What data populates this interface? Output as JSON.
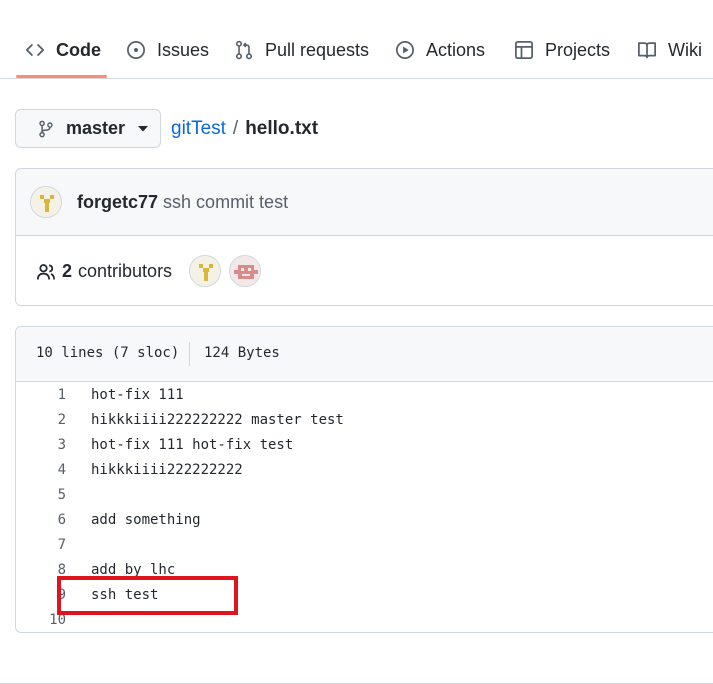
{
  "tabs": [
    {
      "label": "Code",
      "icon": "code-icon",
      "selected": true
    },
    {
      "label": "Issues",
      "icon": "issue-opened-icon",
      "selected": false
    },
    {
      "label": "Pull requests",
      "icon": "git-pull-request-icon",
      "selected": false
    },
    {
      "label": "Actions",
      "icon": "play-icon",
      "selected": false
    },
    {
      "label": "Projects",
      "icon": "table-icon",
      "selected": false
    },
    {
      "label": "Wiki",
      "icon": "book-icon",
      "selected": false
    }
  ],
  "branch": {
    "name": "master",
    "icon": "git-branch-icon"
  },
  "breadcrumb": {
    "repo": "gitTest",
    "separator": "/",
    "file": "hello.txt"
  },
  "commit": {
    "author": "forgetc77",
    "message": "ssh commit test"
  },
  "contributors": {
    "count": "2",
    "label": "contributors"
  },
  "file_info": {
    "lines": "10 lines (7 sloc)",
    "size": "124 Bytes"
  },
  "code_lines": [
    {
      "num": "1",
      "text": "hot-fix 111"
    },
    {
      "num": "2",
      "text": "hikkkiiii222222222 master test"
    },
    {
      "num": "3",
      "text": "hot-fix 111 hot-fix test"
    },
    {
      "num": "4",
      "text": "hikkkiiii222222222"
    },
    {
      "num": "5",
      "text": ""
    },
    {
      "num": "6",
      "text": "add something"
    },
    {
      "num": "7",
      "text": ""
    },
    {
      "num": "8",
      "text": "add by lhc"
    },
    {
      "num": "9",
      "text": "ssh test"
    },
    {
      "num": "10",
      "text": ""
    }
  ],
  "colors": {
    "accent_underline": "#fd8c73",
    "link": "#0969da",
    "annotation_box": "#e0141e"
  }
}
